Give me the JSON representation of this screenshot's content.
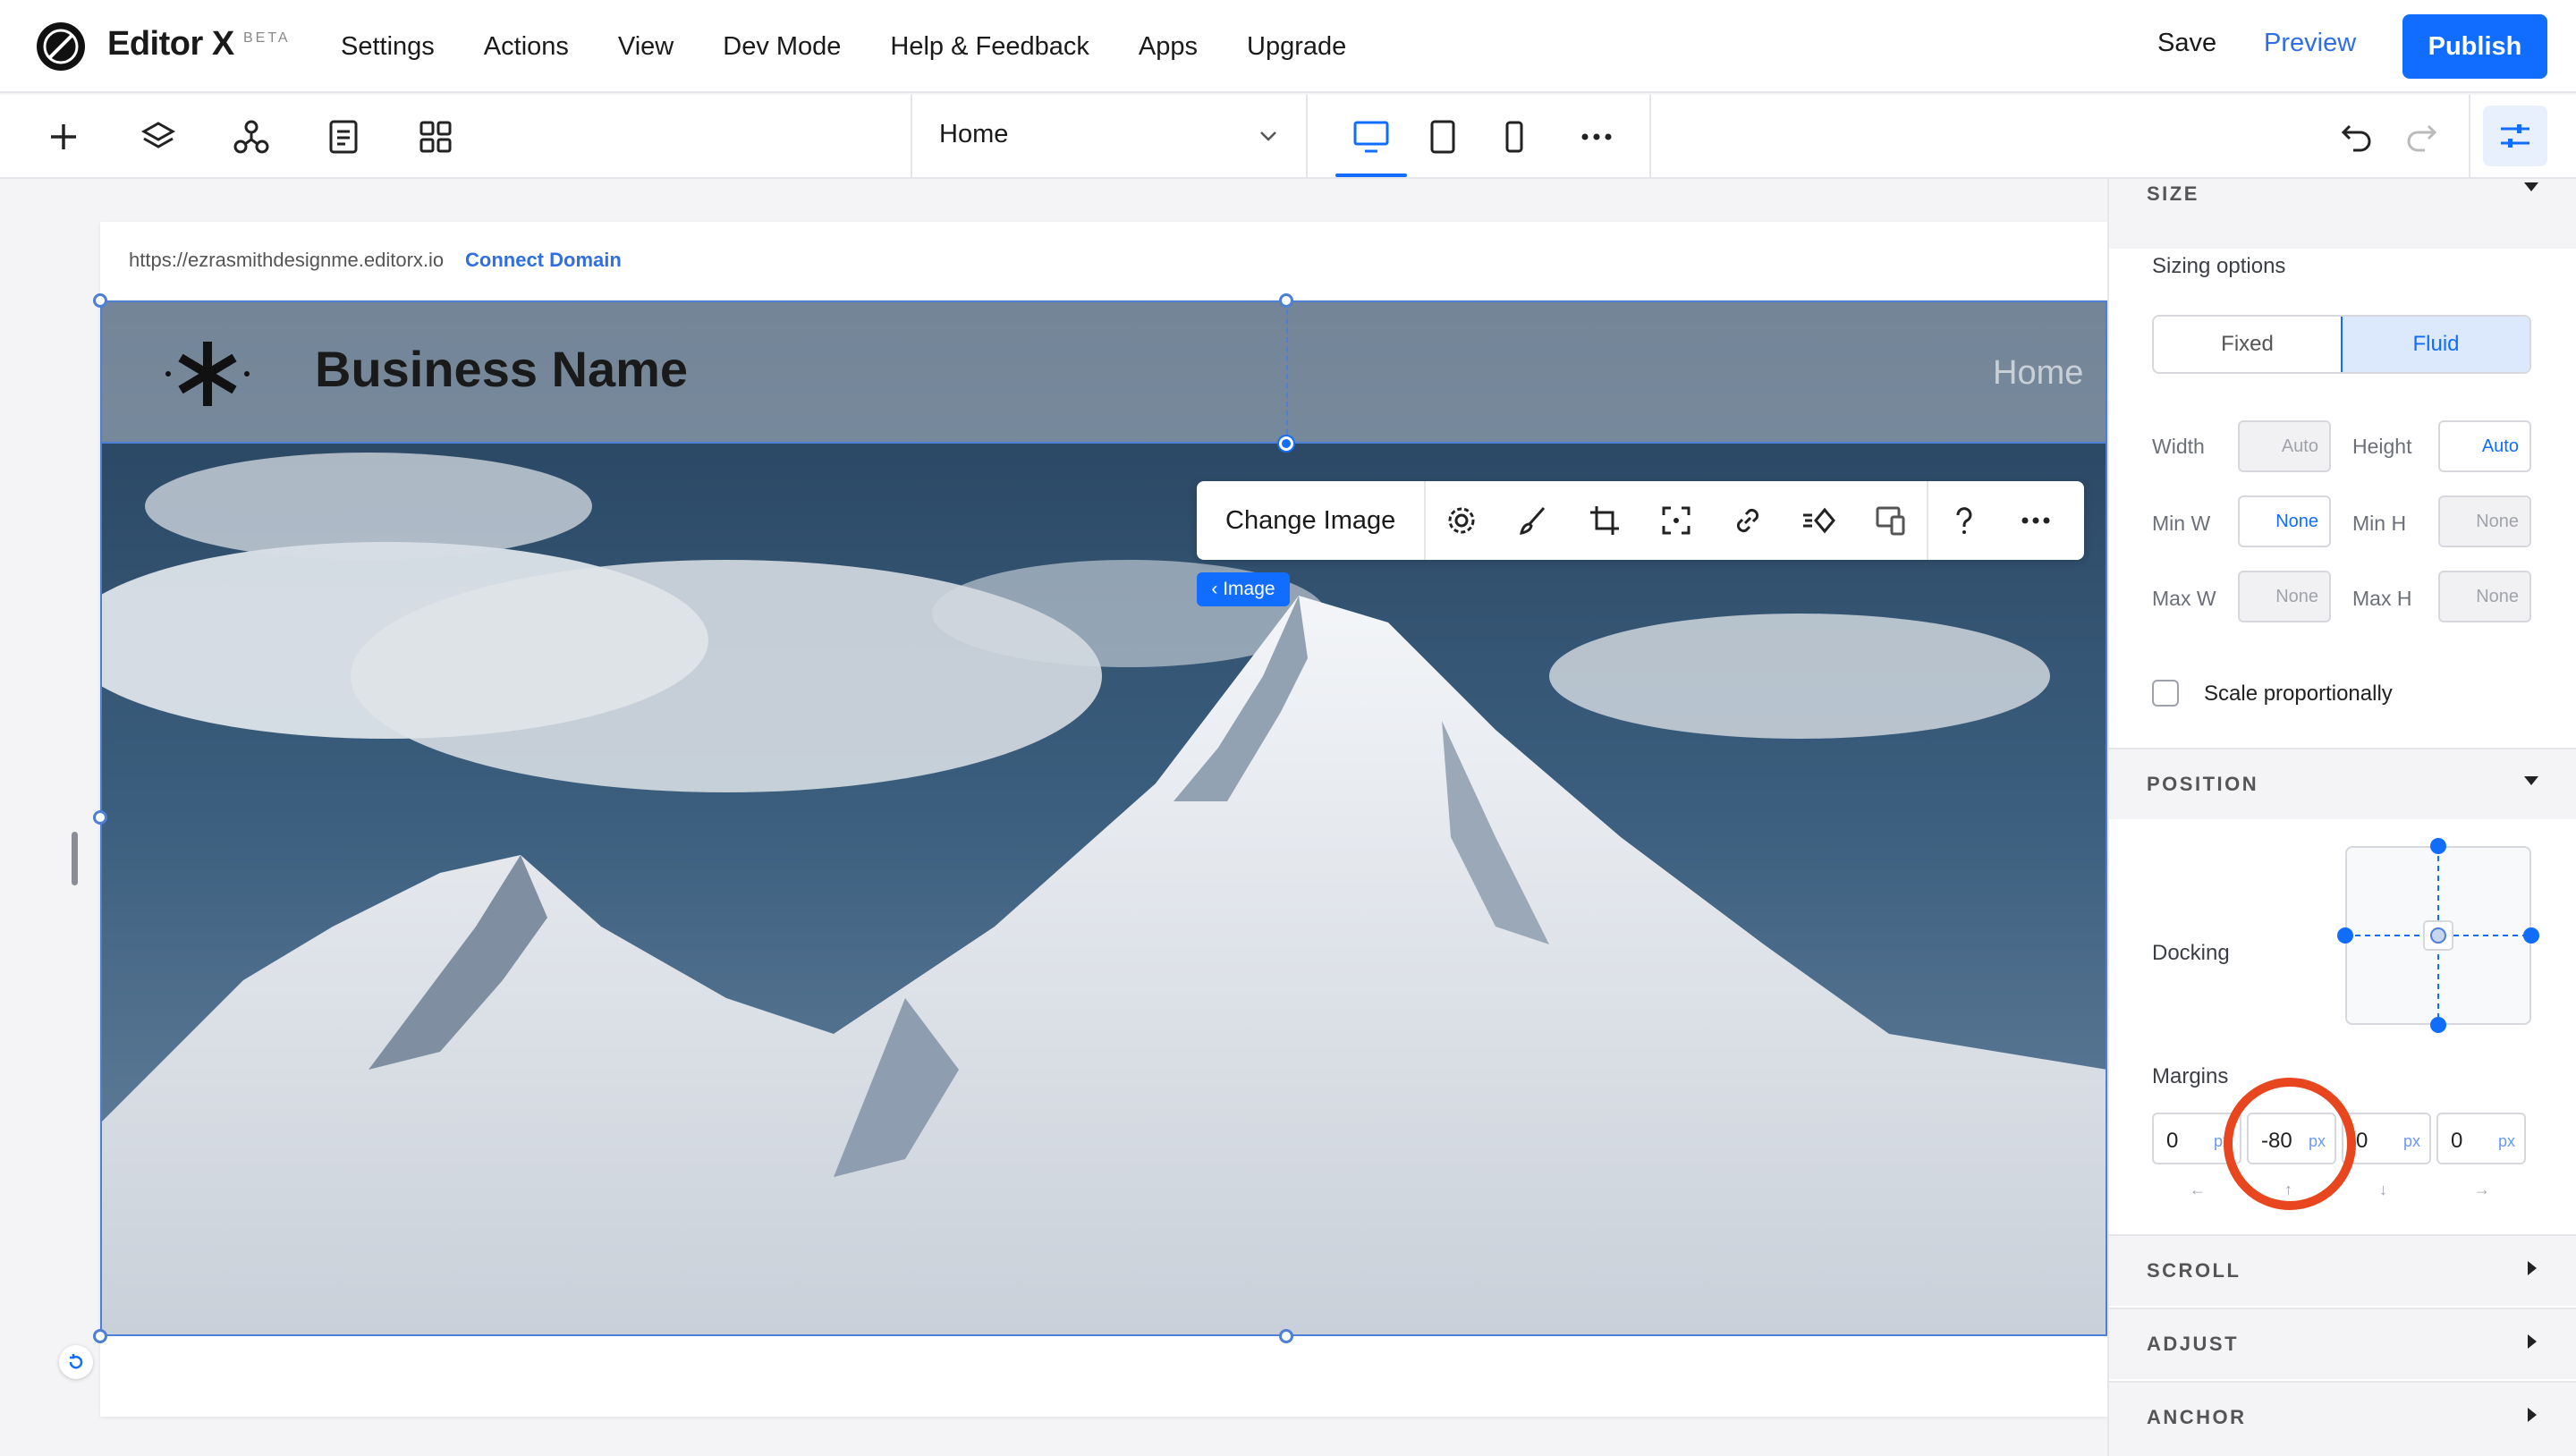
{
  "app": {
    "name": "Editor X",
    "badge": "BETA"
  },
  "menu": [
    "Settings",
    "Actions",
    "View",
    "Dev Mode",
    "Help & Feedback",
    "Apps",
    "Upgrade"
  ],
  "actions": {
    "save": "Save",
    "preview": "Preview",
    "publish": "Publish"
  },
  "toolbar": {
    "page": "Home"
  },
  "canvas": {
    "url": "https://ezrasmithdesignme.editorx.io",
    "connect": "Connect Domain",
    "business_name": "Business Name",
    "nav_home": "Home"
  },
  "context": {
    "change_image": "Change Image",
    "tag": "‹ Image"
  },
  "panel": {
    "size_title": "SIZE",
    "sizing_options": "Sizing options",
    "fixed": "Fixed",
    "fluid": "Fluid",
    "width": "Width",
    "width_val": "Auto",
    "height": "Height",
    "height_val": "Auto",
    "min_w": "Min W",
    "min_w_val": "None",
    "min_h": "Min H",
    "min_h_val": "None",
    "max_w": "Max W",
    "max_w_val": "None",
    "max_h": "Max H",
    "max_h_val": "None",
    "scale": "Scale proportionally",
    "position_title": "POSITION",
    "docking": "Docking",
    "margins": "Margins",
    "margin_vals": [
      "0",
      "-80",
      "0",
      "0"
    ],
    "unit": "px",
    "scroll": "SCROLL",
    "adjust": "ADJUST",
    "anchor": "ANCHOR"
  },
  "colors": {
    "accent": "#116dff",
    "highlight": "#e8461f"
  }
}
